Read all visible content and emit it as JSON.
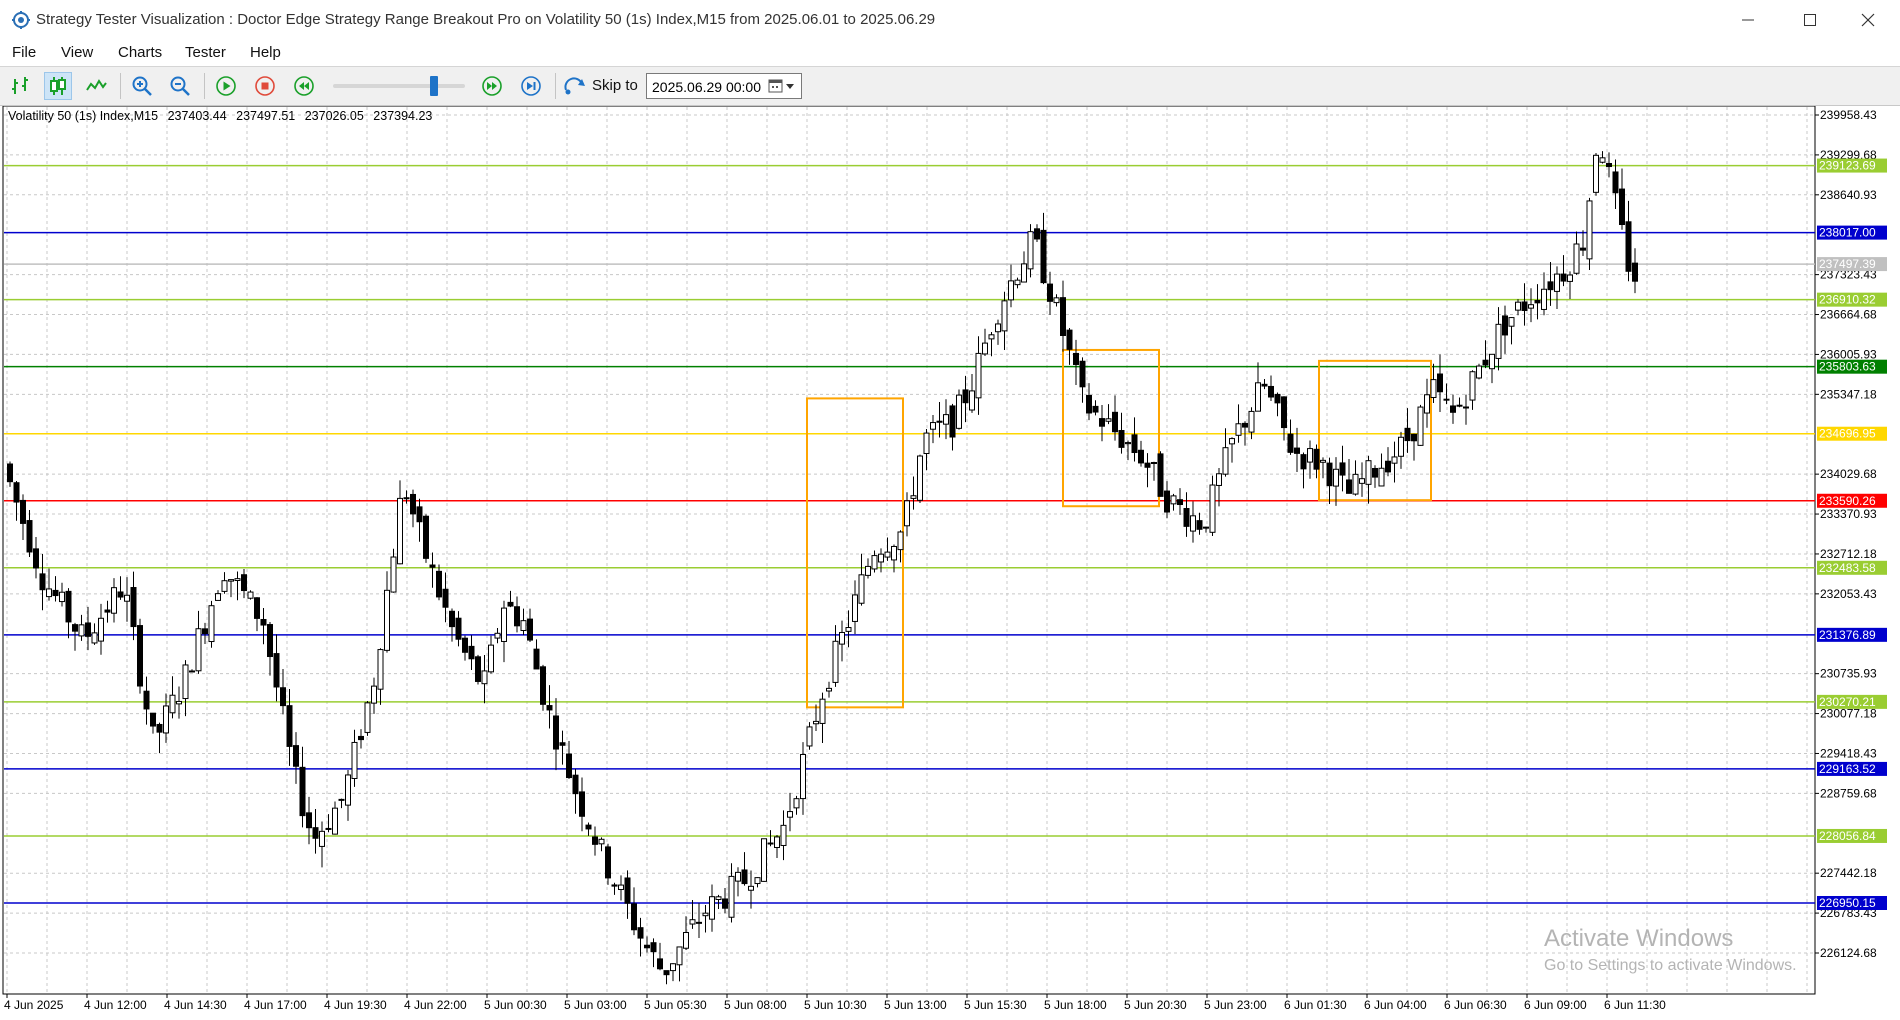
{
  "window": {
    "title": "Strategy Tester Visualization : Doctor Edge Strategy Range Breakout Pro on Volatility 50 (1s) Index,M15 from 2025.06.01 to 2025.06.29",
    "controls": [
      "minimize-icon",
      "maximize-icon",
      "close-icon"
    ]
  },
  "menu": {
    "items": [
      "File",
      "View",
      "Charts",
      "Tester",
      "Help"
    ]
  },
  "toolbar": {
    "buttons": [
      "bar-chart-icon",
      "candlestick-chart-icon",
      "line-chart-icon",
      "zoom-in-icon",
      "zoom-out-icon",
      "play-icon",
      "stop-icon",
      "rewind-icon",
      "fast-forward-icon",
      "skip-to-end-icon"
    ],
    "active_chart_type": "candlestick",
    "speed_level": 0.75,
    "skip_label": "Skip to",
    "skip_date": "2025.06.29 00:00",
    "colors": {
      "green": "#1aa02a",
      "red": "#e04a3a",
      "blue": "#1e73c8"
    }
  },
  "chart": {
    "symbol": "Volatility 50 (1s) Index,M15",
    "ohlc": [
      "237403.44",
      "237497.51",
      "237026.05",
      "237394.23"
    ],
    "price_scale": [
      "239958.43",
      "239299.68",
      "238640.93",
      "237323.43",
      "236664.68",
      "236005.93",
      "235347.18",
      "234029.68",
      "233370.93",
      "232712.18",
      "232053.43",
      "230735.93",
      "230077.18",
      "229418.43",
      "228759.68",
      "227442.18",
      "226783.43",
      "226124.68"
    ],
    "time_scale": [
      "4 Jun 2025",
      "4 Jun 12:00",
      "4 Jun 14:30",
      "4 Jun 17:00",
      "4 Jun 19:30",
      "4 Jun 22:00",
      "5 Jun 00:30",
      "5 Jun 03:00",
      "5 Jun 05:30",
      "5 Jun 08:00",
      "5 Jun 10:30",
      "5 Jun 13:00",
      "5 Jun 15:30",
      "5 Jun 18:00",
      "5 Jun 20:30",
      "5 Jun 23:00",
      "6 Jun 01:30",
      "6 Jun 04:00",
      "6 Jun 06:30",
      "6 Jun 09:00",
      "6 Jun 11:30"
    ],
    "level_lines": [
      {
        "price": "239123.69",
        "color": "#9acd32"
      },
      {
        "price": "238017.00",
        "color": "#0000cd"
      },
      {
        "price": "237497.39",
        "color": "#c0c0c0"
      },
      {
        "price": "236910.32",
        "color": "#9acd32"
      },
      {
        "price": "235803.63",
        "color": "#008000"
      },
      {
        "price": "234696.95",
        "color": "#ffd700"
      },
      {
        "price": "233590.26",
        "color": "#ff0000"
      },
      {
        "price": "232483.58",
        "color": "#9acd32"
      },
      {
        "price": "231376.89",
        "color": "#0000cd"
      },
      {
        "price": "230270.21",
        "color": "#9acd32"
      },
      {
        "price": "229163.52",
        "color": "#0000cd"
      },
      {
        "price": "228056.84",
        "color": "#9acd32"
      },
      {
        "price": "226950.15",
        "color": "#0000cd"
      }
    ],
    "range_boxes": [
      {
        "start": "5 Jun 10:30",
        "end": "5 Jun 13:30",
        "high": "235280",
        "low": "230180",
        "color": "#ffa500"
      },
      {
        "start": "5 Jun 18:30",
        "end": "5 Jun 21:30",
        "high": "236080",
        "low": "233500",
        "color": "#ffa500"
      },
      {
        "start": "6 Jun 02:30",
        "end": "6 Jun 06:00",
        "high": "235900",
        "low": "233600",
        "color": "#ffa500"
      }
    ]
  },
  "watermark": {
    "title": "Activate Windows",
    "subtitle": "Go to Settings to activate Windows."
  }
}
